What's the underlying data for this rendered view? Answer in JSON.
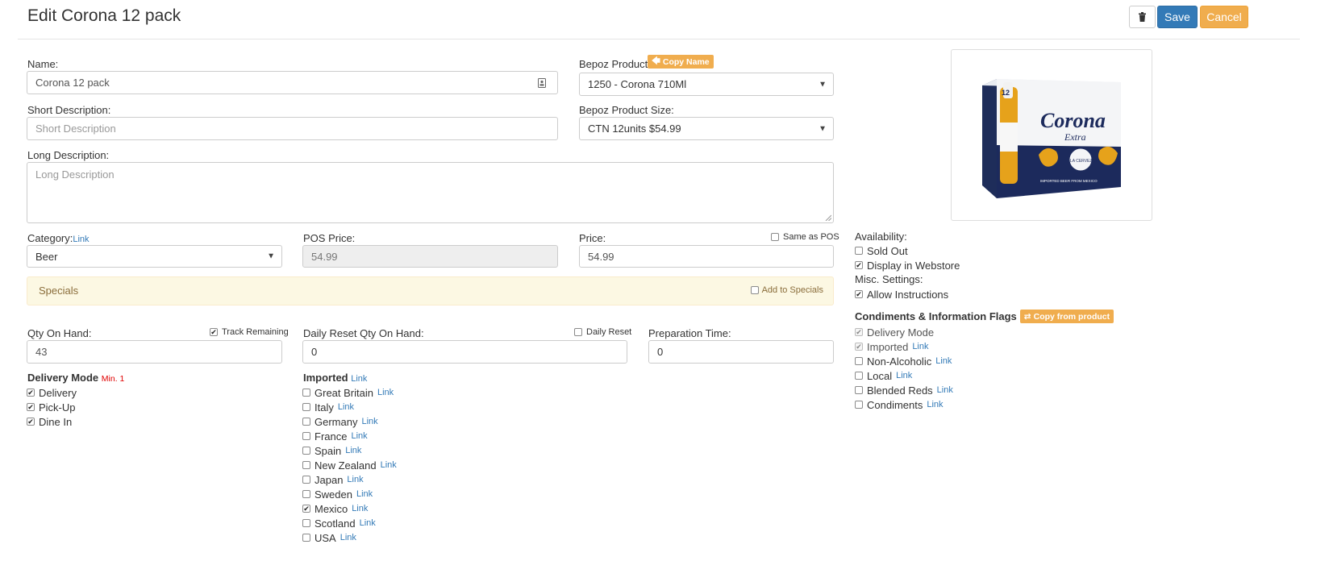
{
  "page": {
    "title": "Edit Corona 12 pack"
  },
  "toolbar": {
    "save_label": "Save",
    "cancel_label": "Cancel"
  },
  "form": {
    "name": {
      "label": "Name:",
      "value": "Corona 12 pack"
    },
    "short_description": {
      "label": "Short Description:",
      "placeholder": "Short Description"
    },
    "long_description": {
      "label": "Long Description:",
      "placeholder": "Long Description"
    },
    "bepoz_product": {
      "label": "Bepoz Product:",
      "copy_label": "Copy Name",
      "value": "1250 - Corona 710Ml"
    },
    "bepoz_product_size": {
      "label": "Bepoz Product Size:",
      "value": "CTN 12units $54.99"
    },
    "category": {
      "label": "Category:",
      "link": "Link",
      "value": "Beer"
    },
    "pos_price": {
      "label": "POS Price:",
      "value": "54.99"
    },
    "price": {
      "label": "Price:",
      "value": "54.99",
      "same_as_pos_label": "Same as POS",
      "same_as_pos_checked": false
    },
    "specials": {
      "title": "Specials",
      "add_label": "Add to Specials",
      "checked": false
    },
    "qty_on_hand": {
      "label": "Qty On Hand:",
      "value": "43",
      "track_label": "Track Remaining",
      "track_checked": true
    },
    "daily_reset": {
      "label": "Daily Reset Qty On Hand:",
      "value": "0",
      "reset_label": "Daily Reset",
      "reset_checked": false
    },
    "prep_time": {
      "label": "Preparation Time:",
      "value": "0"
    }
  },
  "delivery_mode": {
    "title": "Delivery Mode",
    "min_label": "Min. 1",
    "options": [
      {
        "label": "Delivery",
        "checked": true
      },
      {
        "label": "Pick-Up",
        "checked": true
      },
      {
        "label": "Dine In",
        "checked": true
      }
    ]
  },
  "imported": {
    "title": "Imported",
    "link": "Link",
    "options": [
      {
        "label": "Great Britain",
        "link": "Link",
        "checked": false
      },
      {
        "label": "Italy",
        "link": "Link",
        "checked": false
      },
      {
        "label": "Germany",
        "link": "Link",
        "checked": false
      },
      {
        "label": "France",
        "link": "Link",
        "checked": false
      },
      {
        "label": "Spain",
        "link": "Link",
        "checked": false
      },
      {
        "label": "New Zealand",
        "link": "Link",
        "checked": false
      },
      {
        "label": "Japan",
        "link": "Link",
        "checked": false
      },
      {
        "label": "Sweden",
        "link": "Link",
        "checked": false
      },
      {
        "label": "Mexico",
        "link": "Link",
        "checked": true
      },
      {
        "label": "Scotland",
        "link": "Link",
        "checked": false
      },
      {
        "label": "USA",
        "link": "Link",
        "checked": false
      }
    ]
  },
  "availability": {
    "title": "Availability:",
    "options": [
      {
        "label": "Sold Out",
        "checked": false
      },
      {
        "label": "Display in Webstore",
        "checked": true
      }
    ]
  },
  "misc": {
    "title": "Misc. Settings:",
    "options": [
      {
        "label": "Allow Instructions",
        "checked": true
      }
    ]
  },
  "condiments": {
    "title": "Condiments & Information Flags",
    "copy_label": "Copy from product",
    "flags": [
      {
        "label": "Delivery Mode",
        "link": "",
        "checked": true,
        "disabled": true
      },
      {
        "label": "Imported",
        "link": "Link",
        "checked": true,
        "disabled": true
      },
      {
        "label": "Non-Alcoholic",
        "link": "Link",
        "checked": false,
        "disabled": false
      },
      {
        "label": "Local",
        "link": "Link",
        "checked": false,
        "disabled": false
      },
      {
        "label": "Blended Reds",
        "link": "Link",
        "checked": false,
        "disabled": false
      },
      {
        "label": "Condiments",
        "link": "Link",
        "checked": false,
        "disabled": false
      }
    ]
  },
  "product_image": {
    "box_label": "12",
    "brand": "Corona",
    "sub_brand": "Extra",
    "seal_text": "LA CERVEZA MAS FINA",
    "tagline": "IMPORTED BEER FROM MEXICO"
  },
  "icons": {
    "trash": "trash-icon",
    "arrow_left": "arrow-left-icon",
    "exchange": "exchange-icon",
    "id_card": "contact-card-icon"
  },
  "colors": {
    "primary": "#337ab7",
    "warning": "#f0ad4e",
    "specials_bg": "#fcf8e3",
    "error": "#e00000"
  }
}
